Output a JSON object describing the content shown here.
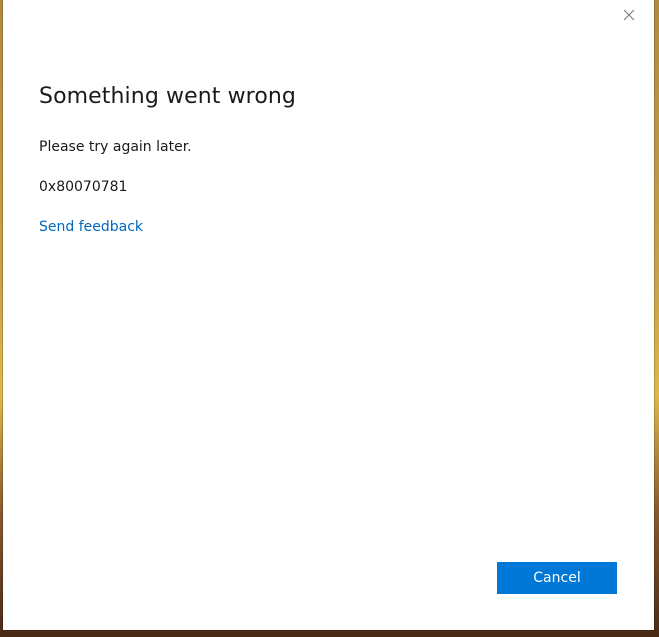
{
  "dialog": {
    "title": "Something went wrong",
    "message": "Please try again later.",
    "error_code": "0x80070781",
    "feedback_link": "Send feedback",
    "cancel_label": "Cancel",
    "close_icon": "close-icon"
  },
  "colors": {
    "accent": "#0078d7",
    "link": "#0067c0",
    "text": "#1a1a1a",
    "background": "#ffffff"
  }
}
